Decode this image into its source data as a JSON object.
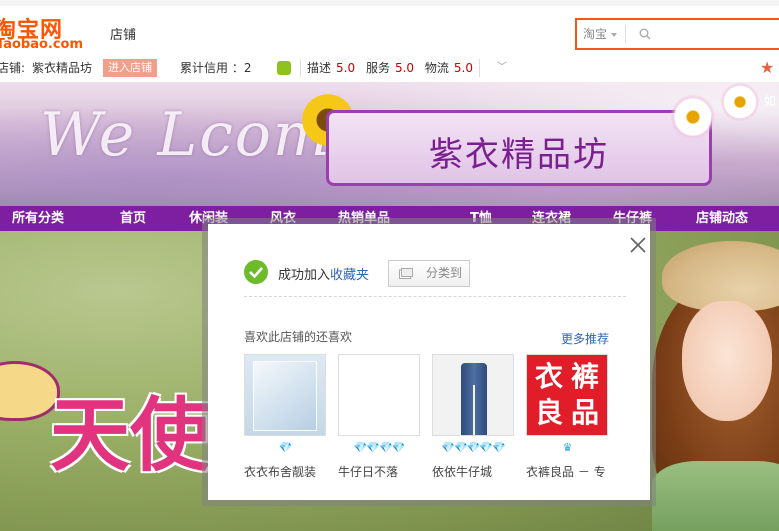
{
  "header": {
    "logo_cn": "淘宝网",
    "logo_en": "Taobao.com",
    "section_label": "店铺",
    "search_scope": "淘宝"
  },
  "shop_bar": {
    "shop_prefix": "店铺:",
    "shop_name": "紫衣精品坊",
    "enter_shop_label": "进入店铺",
    "credit_label": "累计信用 ：2",
    "dsr": [
      {
        "label": "描述",
        "score": "5.0"
      },
      {
        "label": "服务",
        "score": "5.0"
      },
      {
        "label": "物流",
        "score": "5.0"
      }
    ]
  },
  "banner": {
    "welcome_text": "We Lcome",
    "shop_title": "紫衣精品坊",
    "right_text": "如"
  },
  "nav": {
    "items": [
      "所有分类",
      "首页",
      "休闲装",
      "风衣",
      "热销单品",
      "T恤",
      "连衣裙",
      "牛仔裤",
      "店铺动态"
    ]
  },
  "hero": {
    "title": "天使"
  },
  "popup": {
    "success_prefix": "成功加入",
    "success_link": "收藏夹",
    "category_button_label": "分类到",
    "recommend_title": "喜欢此店铺的还喜欢",
    "more_recommend_label": "更多推荐",
    "items": [
      {
        "name": "衣衣布舍靓装",
        "diamonds": "💎"
      },
      {
        "name": "牛仔日不落",
        "diamonds": "💎💎💎💎"
      },
      {
        "name": "依依牛仔城",
        "diamonds": "💎💎💎💎💎"
      },
      {
        "name": "衣裤良品 － 专",
        "diamonds": "♛",
        "thumb_text": [
          "衣",
          "裤",
          "良",
          "品"
        ]
      }
    ]
  },
  "colors": {
    "brand_orange": "#ff5500",
    "nav_purple": "#7d1fa0",
    "link_blue": "#2f66b3",
    "score_red": "#cc0000",
    "success_green": "#6dbb2b"
  }
}
